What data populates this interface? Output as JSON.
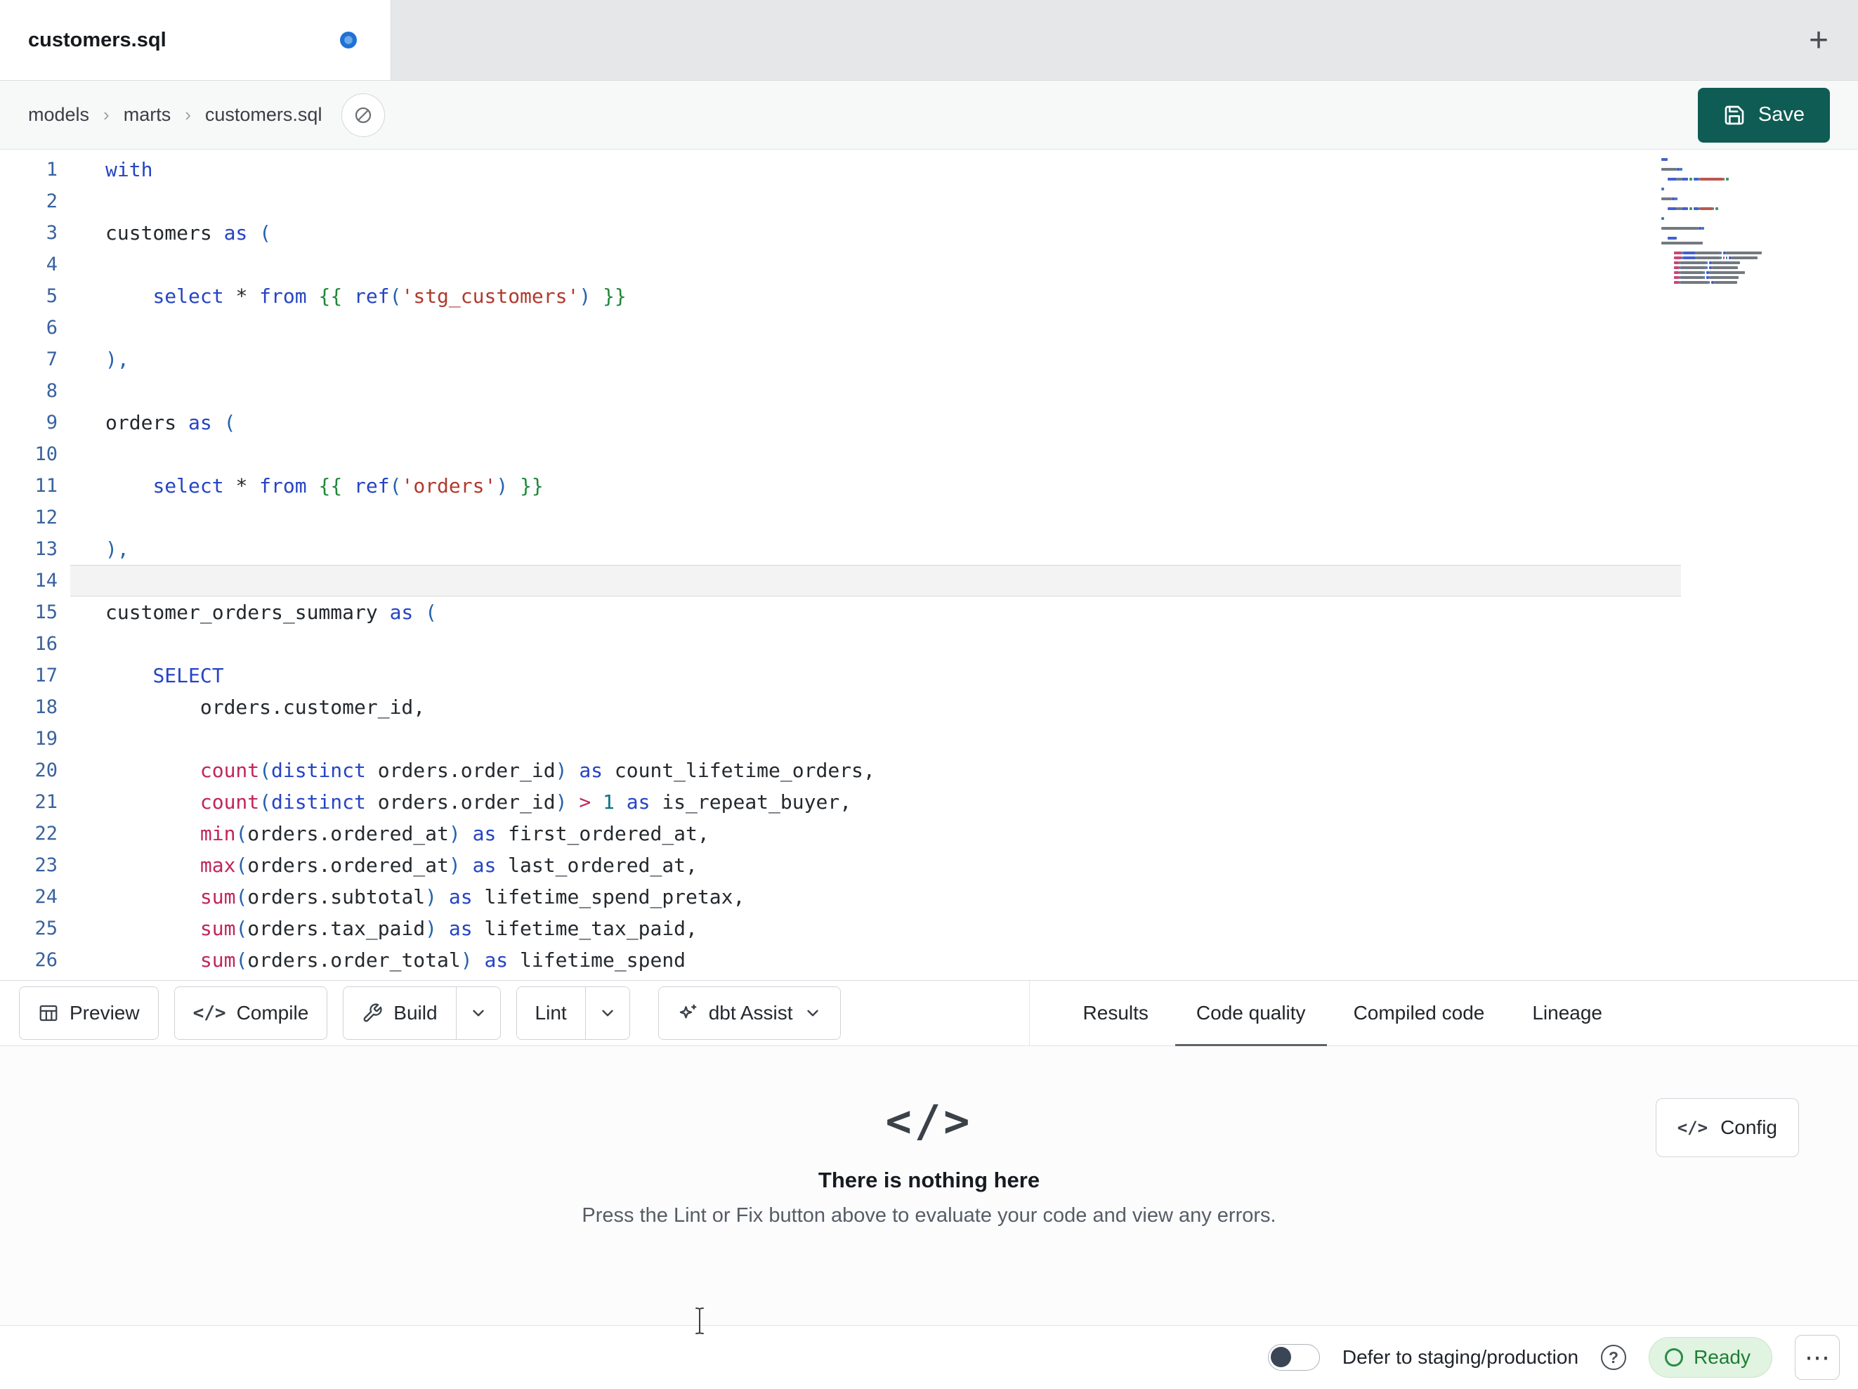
{
  "colors": {
    "accent": "#0f5c54",
    "modified-dot": "#1f72d4",
    "kw": "#2544c4",
    "fn": "#c2255c",
    "str": "#b03a2e",
    "jinja": "#208838",
    "num": "#0b7285",
    "op": "#c2255c",
    "br": "#2563ad",
    "plain": "#24292e",
    "gutter": "#39629e",
    "ready-bg": "#e1f3e1",
    "ready-fg": "#1e7e34"
  },
  "tabbar": {
    "tab_title": "customers.sql",
    "new_tab": "+"
  },
  "breadcrumb": {
    "items": [
      "models",
      "marts",
      "customers.sql"
    ],
    "separator": "›"
  },
  "save": {
    "label": "Save"
  },
  "editor": {
    "active_line": 14,
    "lines": [
      {
        "n": 1,
        "tokens": [
          [
            "kw",
            "with"
          ]
        ]
      },
      {
        "n": 2,
        "tokens": []
      },
      {
        "n": 3,
        "tokens": [
          [
            "plain",
            "customers "
          ],
          [
            "kw",
            "as"
          ],
          [
            "br",
            " ("
          ]
        ]
      },
      {
        "n": 4,
        "tokens": []
      },
      {
        "n": 5,
        "tokens": [
          [
            "plain",
            "    "
          ],
          [
            "kw",
            "select"
          ],
          [
            "plain",
            " * "
          ],
          [
            "kw",
            "from"
          ],
          [
            "plain",
            " "
          ],
          [
            "jinja",
            "{{"
          ],
          [
            "plain",
            " "
          ],
          [
            "kw",
            "ref"
          ],
          [
            "br",
            "("
          ],
          [
            "str",
            "'stg_customers'"
          ],
          [
            "br",
            ")"
          ],
          [
            "plain",
            " "
          ],
          [
            "jinja",
            "}}"
          ]
        ]
      },
      {
        "n": 6,
        "tokens": []
      },
      {
        "n": 7,
        "tokens": [
          [
            "br",
            "),"
          ]
        ]
      },
      {
        "n": 8,
        "tokens": []
      },
      {
        "n": 9,
        "tokens": [
          [
            "plain",
            "orders "
          ],
          [
            "kw",
            "as"
          ],
          [
            "br",
            " ("
          ]
        ]
      },
      {
        "n": 10,
        "tokens": []
      },
      {
        "n": 11,
        "tokens": [
          [
            "plain",
            "    "
          ],
          [
            "kw",
            "select"
          ],
          [
            "plain",
            " * "
          ],
          [
            "kw",
            "from"
          ],
          [
            "plain",
            " "
          ],
          [
            "jinja",
            "{{"
          ],
          [
            "plain",
            " "
          ],
          [
            "kw",
            "ref"
          ],
          [
            "br",
            "("
          ],
          [
            "str",
            "'orders'"
          ],
          [
            "br",
            ")"
          ],
          [
            "plain",
            " "
          ],
          [
            "jinja",
            "}}"
          ]
        ]
      },
      {
        "n": 12,
        "tokens": []
      },
      {
        "n": 13,
        "tokens": [
          [
            "br",
            "),"
          ]
        ]
      },
      {
        "n": 14,
        "tokens": []
      },
      {
        "n": 15,
        "tokens": [
          [
            "plain",
            "customer_orders_summary "
          ],
          [
            "kw",
            "as"
          ],
          [
            "br",
            " ("
          ]
        ]
      },
      {
        "n": 16,
        "tokens": []
      },
      {
        "n": 17,
        "tokens": [
          [
            "plain",
            "    "
          ],
          [
            "kw",
            "SELECT"
          ]
        ]
      },
      {
        "n": 18,
        "tokens": [
          [
            "plain",
            "        orders.customer_id,"
          ]
        ]
      },
      {
        "n": 19,
        "tokens": []
      },
      {
        "n": 20,
        "tokens": [
          [
            "plain",
            "        "
          ],
          [
            "fn",
            "count"
          ],
          [
            "br",
            "("
          ],
          [
            "kw",
            "distinct"
          ],
          [
            "plain",
            " orders.order_id"
          ],
          [
            "br",
            ")"
          ],
          [
            "plain",
            " "
          ],
          [
            "kw",
            "as"
          ],
          [
            "plain",
            " count_lifetime_orders,"
          ]
        ]
      },
      {
        "n": 21,
        "tokens": [
          [
            "plain",
            "        "
          ],
          [
            "fn",
            "count"
          ],
          [
            "br",
            "("
          ],
          [
            "kw",
            "distinct"
          ],
          [
            "plain",
            " orders.order_id"
          ],
          [
            "br",
            ")"
          ],
          [
            "plain",
            " "
          ],
          [
            "op",
            ">"
          ],
          [
            "plain",
            " "
          ],
          [
            "num",
            "1"
          ],
          [
            "plain",
            " "
          ],
          [
            "kw",
            "as"
          ],
          [
            "plain",
            " is_repeat_buyer,"
          ]
        ]
      },
      {
        "n": 22,
        "tokens": [
          [
            "plain",
            "        "
          ],
          [
            "fn",
            "min"
          ],
          [
            "br",
            "("
          ],
          [
            "plain",
            "orders.ordered_at"
          ],
          [
            "br",
            ")"
          ],
          [
            "plain",
            " "
          ],
          [
            "kw",
            "as"
          ],
          [
            "plain",
            " first_ordered_at,"
          ]
        ]
      },
      {
        "n": 23,
        "tokens": [
          [
            "plain",
            "        "
          ],
          [
            "fn",
            "max"
          ],
          [
            "br",
            "("
          ],
          [
            "plain",
            "orders.ordered_at"
          ],
          [
            "br",
            ")"
          ],
          [
            "plain",
            " "
          ],
          [
            "kw",
            "as"
          ],
          [
            "plain",
            " last_ordered_at,"
          ]
        ]
      },
      {
        "n": 24,
        "tokens": [
          [
            "plain",
            "        "
          ],
          [
            "fn",
            "sum"
          ],
          [
            "br",
            "("
          ],
          [
            "plain",
            "orders.subtotal"
          ],
          [
            "br",
            ")"
          ],
          [
            "plain",
            " "
          ],
          [
            "kw",
            "as"
          ],
          [
            "plain",
            " lifetime_spend_pretax,"
          ]
        ]
      },
      {
        "n": 25,
        "tokens": [
          [
            "plain",
            "        "
          ],
          [
            "fn",
            "sum"
          ],
          [
            "br",
            "("
          ],
          [
            "plain",
            "orders.tax_paid"
          ],
          [
            "br",
            ")"
          ],
          [
            "plain",
            " "
          ],
          [
            "kw",
            "as"
          ],
          [
            "plain",
            " lifetime_tax_paid,"
          ]
        ]
      },
      {
        "n": 26,
        "tokens": [
          [
            "plain",
            "        "
          ],
          [
            "fn",
            "sum"
          ],
          [
            "br",
            "("
          ],
          [
            "plain",
            "orders.order_total"
          ],
          [
            "br",
            ")"
          ],
          [
            "plain",
            " "
          ],
          [
            "kw",
            "as"
          ],
          [
            "plain",
            " lifetime_spend"
          ]
        ]
      }
    ]
  },
  "toolbar": {
    "preview": "Preview",
    "compile": "Compile",
    "compile_icon": "</>",
    "build": "Build",
    "lint": "Lint",
    "assist": "dbt Assist"
  },
  "panel_tabs": [
    {
      "label": "Results",
      "active": false
    },
    {
      "label": "Code quality",
      "active": true
    },
    {
      "label": "Compiled code",
      "active": false
    },
    {
      "label": "Lineage",
      "active": false
    }
  ],
  "empty_state": {
    "icon": "</>",
    "title": "There is nothing here",
    "subtitle": "Press the Lint or Fix button above to evaluate your code and view any errors.",
    "config_label": "Config",
    "config_icon": "</>"
  },
  "statusbar": {
    "defer_label": "Defer to staging/production",
    "help_glyph": "?",
    "ready_label": "Ready",
    "menu_glyph": "⋯"
  }
}
